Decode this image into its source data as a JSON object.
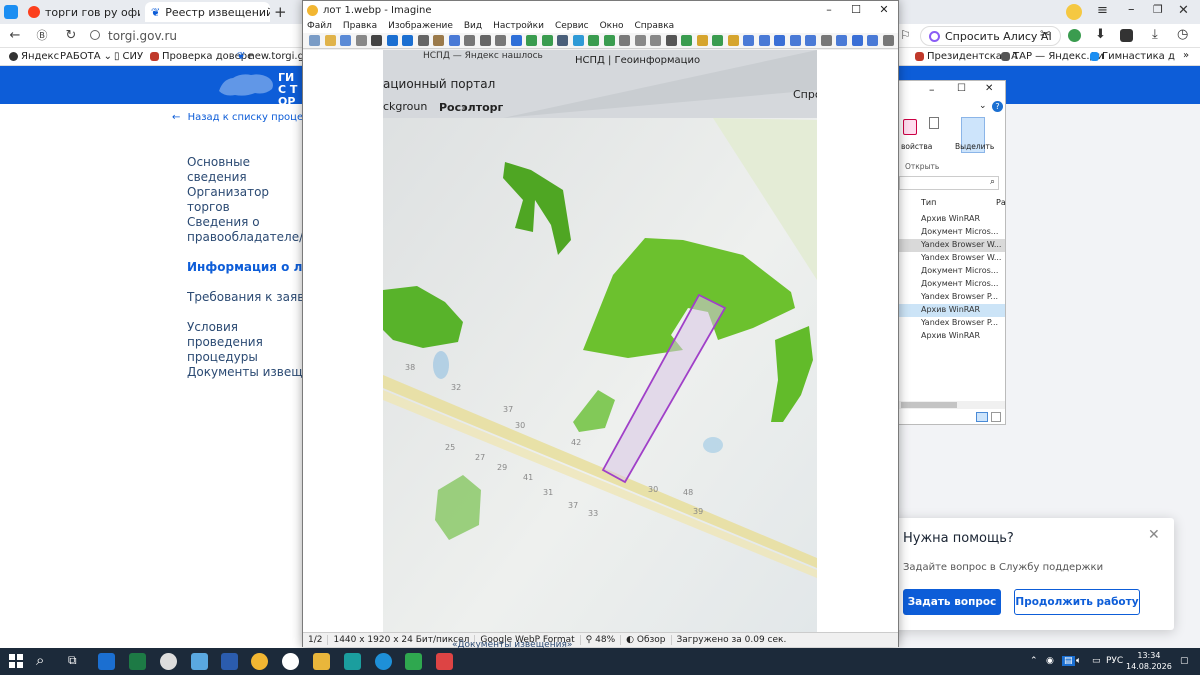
{
  "browser": {
    "tabs": [
      {
        "label": "торги гов ру официальны"
      },
      {
        "label": "Реестр извещений"
      }
    ],
    "url": "torgi.gov.ru",
    "ask_alice": "Спросить Алису AI",
    "bookmarks": [
      "Яндекс",
      "РАБОТА",
      "СИУ",
      "Проверка довере",
      "new.torgi.gov",
      "Президентская А",
      "ТАР — Яндекс.Ди",
      "Гимнастика д"
    ]
  },
  "site": {
    "header_title": "ГИС ТОРГИ",
    "back_link": "Назад к списку процедур",
    "nav": [
      {
        "label": "Основные сведения",
        "current": false
      },
      {
        "label": "Организатор торгов",
        "current": false
      },
      {
        "label": "Сведения о правообладателе/ инициаторе торгов",
        "current": false
      },
      {
        "label": "Информация о лотах",
        "current": true
      },
      {
        "label": "Требования к заявкам",
        "current": false
      },
      {
        "label": "Условия проведения процедуры",
        "current": false
      },
      {
        "label": "Документы извещения",
        "current": false
      }
    ],
    "behind_text": "«Документы извещения»"
  },
  "imagine": {
    "title": "лот 1.webp - Imagine",
    "menu": [
      "Файл",
      "Правка",
      "Изображение",
      "Вид",
      "Настройки",
      "Сервис",
      "Окно",
      "Справка"
    ],
    "status": {
      "page": "1/2",
      "dimensions": "1440 x 1920 x 24 Бит/пиксел",
      "format": "Google WebP Format",
      "zoom": "48%",
      "view": "Обзор",
      "loaded": "Загружено за 0.09 сек."
    },
    "photo": {
      "portal_text": "ационный портал",
      "tab_text": "НСПД | Геоинформацио",
      "tab_text2": "НСПД — Яндекс нашлось",
      "ask_text": "Спро",
      "bg_text": "ckgroun",
      "rosreestr": "Росэлторг",
      "numbers": [
        "38",
        "32",
        "37",
        "30",
        "25",
        "27",
        "29",
        "41",
        "42",
        "31",
        "37",
        "33",
        "30",
        "48",
        "39"
      ]
    }
  },
  "explorer": {
    "ribbon_properties": "войства",
    "ribbon_open": "Открыть",
    "ribbon_select": "Выделить",
    "col_type": "Тип",
    "col_size": "Ра",
    "files": [
      {
        "type": "Архив WinRAR",
        "selected": false
      },
      {
        "type": "Документ Micros...",
        "selected": false
      },
      {
        "type": "Yandex Browser W...",
        "selected": true
      },
      {
        "type": "Yandex Browser W...",
        "selected": false
      },
      {
        "type": "Документ Micros...",
        "selected": false
      },
      {
        "type": "Документ Micros...",
        "selected": false
      },
      {
        "type": "Yandex Browser P...",
        "selected": false
      },
      {
        "type": "Архив WinRAR",
        "selected": true
      },
      {
        "type": "Yandex Browser P...",
        "selected": false
      },
      {
        "type": "Архив WinRAR",
        "selected": false
      }
    ]
  },
  "help": {
    "title": "Нужна помощь?",
    "text": "Задайте вопрос в Службу поддержки",
    "ask_button": "Задать вопрос",
    "continue_button": "Продолжить работу"
  },
  "taskbar": {
    "lang": "РУС",
    "time": "13:34",
    "date": "14.08.2026"
  },
  "colors": {
    "site_blue": "#0d5dd8",
    "taskbar": "#1c2a3a",
    "green_area": "#6cc12e",
    "parcel_outline": "#a040c8"
  }
}
